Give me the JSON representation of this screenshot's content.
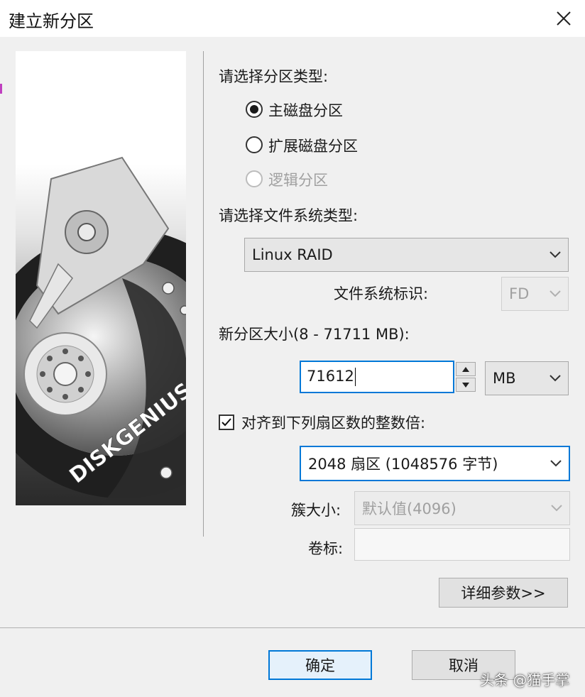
{
  "window": {
    "title": "建立新分区"
  },
  "partition_type": {
    "label": "请选择分区类型:",
    "options": [
      {
        "label": "主磁盘分区",
        "selected": true,
        "enabled": true
      },
      {
        "label": "扩展磁盘分区",
        "selected": false,
        "enabled": true
      },
      {
        "label": "逻辑分区",
        "selected": false,
        "enabled": false
      }
    ]
  },
  "filesystem": {
    "label": "请选择文件系统类型:",
    "selected": "Linux RAID",
    "id_label": "文件系统标识:",
    "id_value": "FD"
  },
  "size": {
    "label": "新分区大小(8 - 71711 MB):",
    "value": "71612",
    "unit": "MB"
  },
  "align": {
    "label": "对齐到下列扇区数的整数倍:",
    "checked": true,
    "value": "2048 扇区 (1048576 字节)"
  },
  "cluster": {
    "label": "簇大小:",
    "value": "默认值(4096)"
  },
  "volume": {
    "label": "卷标:",
    "value": ""
  },
  "buttons": {
    "details": "详细参数>>",
    "ok": "确定",
    "cancel": "取消"
  },
  "banner": {
    "brand": "DISKGENIUS"
  },
  "watermark": "头条 @猫手掌",
  "colors": {
    "accent": "#0078d7",
    "disabled": "#a0a0a0"
  }
}
